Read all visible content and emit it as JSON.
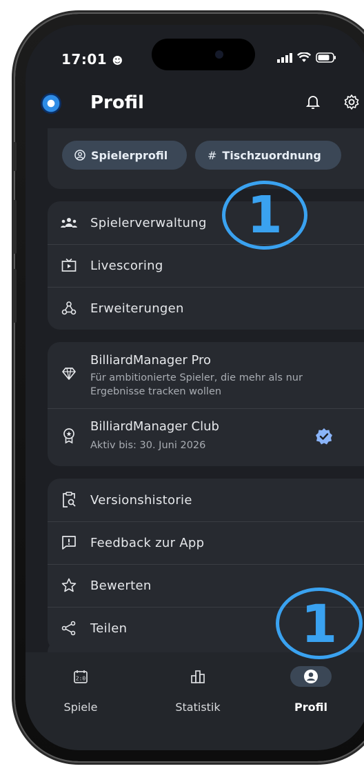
{
  "status_bar": {
    "time": "17:01"
  },
  "header": {
    "title": "Profil"
  },
  "chips": {
    "player_profile": "Spielerprofil",
    "table_assignment": "Tischzuordnung"
  },
  "menu_main": {
    "player_management": "Spielerverwaltung",
    "livescoring": "Livescoring",
    "extensions": "Erweiterungen"
  },
  "subscriptions": {
    "pro_title": "BilliardManager Pro",
    "pro_sub_1": "Für ambitionierte Spieler, die mehr als nur",
    "pro_sub_2": "Ergebnisse tracken wollen",
    "club_title": "BilliardManager Club",
    "club_sub": "Aktiv bis: 30. Juni 2026"
  },
  "menu_more": {
    "version_history": "Versionshistorie",
    "feedback": "Feedback zur App",
    "rate": "Bewerten",
    "share": "Teilen"
  },
  "bottom_nav": {
    "games": "Spiele",
    "stats": "Statistik",
    "profile": "Profil"
  },
  "annotations": {
    "top": "1",
    "bottom": "1"
  },
  "colors": {
    "background": "#1d1f24",
    "card": "#272a30",
    "chip": "#3b4756",
    "accent": "#3aa2f0",
    "verified": "#8ab4f8"
  }
}
